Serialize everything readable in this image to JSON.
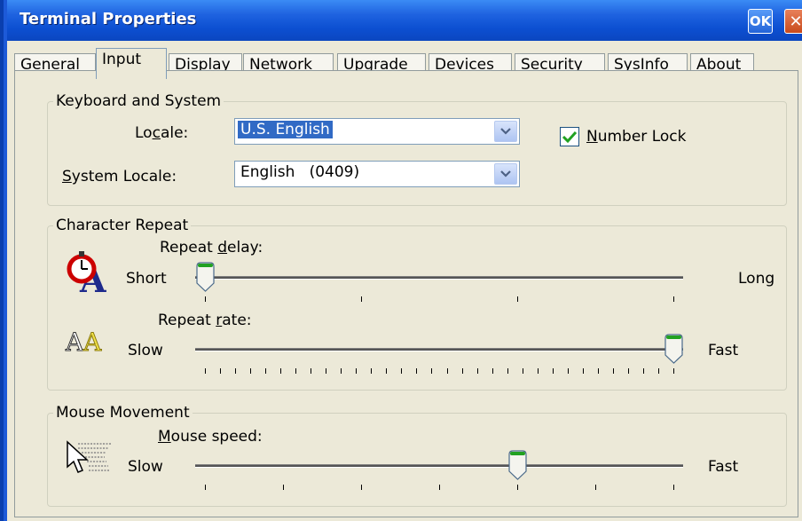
{
  "window": {
    "title": "Terminal Properties",
    "ok_label": "OK",
    "close_glyph": "✕"
  },
  "tabs": [
    {
      "label": "General",
      "active": false
    },
    {
      "label": "Input",
      "active": true
    },
    {
      "label": "Display",
      "active": false
    },
    {
      "label": "Network",
      "active": false
    },
    {
      "label": "Upgrade",
      "active": false
    },
    {
      "label": "Devices",
      "active": false
    },
    {
      "label": "Security",
      "active": false
    },
    {
      "label": "SysInfo",
      "active": false
    },
    {
      "label": "About",
      "active": false
    }
  ],
  "keyboard": {
    "group_label": "Keyboard and System",
    "locale_label_pre": "Lo",
    "locale_label_u": "c",
    "locale_label_post": "ale:",
    "locale_value": "U.S. English",
    "system_locale_label_u": "S",
    "system_locale_label_post": "ystem Locale:",
    "system_locale_value": "English   (0409)",
    "number_lock_u": "N",
    "number_lock_post": "umber Lock",
    "number_lock_checked": true
  },
  "char_repeat": {
    "group_label": "Character Repeat",
    "delay_label_pre": "Repeat ",
    "delay_label_u": "d",
    "delay_label_post": "elay:",
    "delay_min_label": "Short",
    "delay_max_label": "Long",
    "delay_value_fraction": 0.0,
    "rate_label_pre": "Repeat ",
    "rate_label_u": "r",
    "rate_label_post": "ate:",
    "rate_min_label": "Slow",
    "rate_max_label": "Fast",
    "rate_value_fraction": 1.0
  },
  "mouse": {
    "group_label": "Mouse Movement",
    "speed_label_u": "M",
    "speed_label_post": "ouse speed:",
    "speed_min_label": "Slow",
    "speed_max_label": "Fast",
    "speed_value_fraction": 0.6667
  },
  "icons": {
    "delay": "stopwatch-letter-icon",
    "rate": "repeat-letters-icon",
    "mouse": "mouse-pointer-icon",
    "combo_arrow": "chevron-down-icon",
    "check": "checkmark-icon"
  },
  "colors": {
    "title_bar": "#0c4fd1",
    "selection": "#316ac5",
    "check_green": "#21a121",
    "thumb_green": "#21a121"
  }
}
